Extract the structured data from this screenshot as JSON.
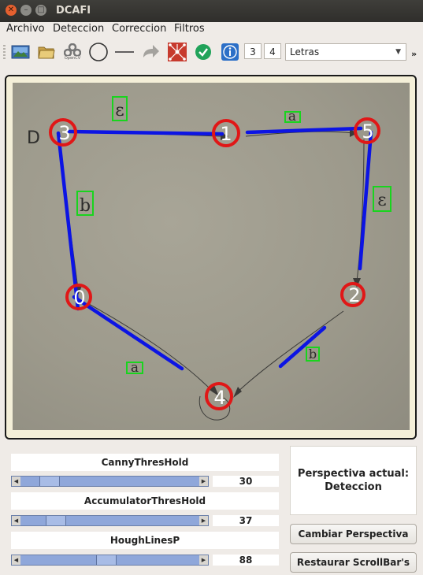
{
  "window": {
    "title": "DCAFI"
  },
  "menu": [
    "Archivo",
    "Deteccion",
    "Correccion",
    "Filtros"
  ],
  "toolbar": {
    "icons": [
      "image-icon",
      "folder-icon",
      "opencv-icon",
      "circle-icon",
      "line-icon",
      "redo-arrow-icon",
      "graph-icon",
      "check-icon",
      "info-icon"
    ],
    "opencv_label": "OpenCV",
    "spin1": "3",
    "spin2": "4",
    "combo_value": "Letras",
    "overflow": "»"
  },
  "graph": {
    "nodes": [
      {
        "label": "3"
      },
      {
        "label": "1"
      },
      {
        "label": "5"
      },
      {
        "label": "0"
      },
      {
        "label": "2"
      },
      {
        "label": "4"
      }
    ],
    "edge_labels": [
      "ε",
      "a",
      "b",
      "ε",
      "a",
      "b"
    ],
    "start_marker": "D"
  },
  "controls": {
    "canny": {
      "label": "CannyThresHold",
      "value": "30",
      "level": 0.12
    },
    "accumulator": {
      "label": "AccumulatorThresHold",
      "value": "37",
      "level": 0.16
    },
    "houghlines": {
      "label": "HoughLinesP",
      "value": "88",
      "level": 0.48
    }
  },
  "perspective": {
    "line1": "Perspectiva actual:",
    "line2": "Deteccion"
  },
  "buttons": {
    "change": "Cambiar Perspectiva",
    "restore": "Restaurar ScrollBar's"
  }
}
